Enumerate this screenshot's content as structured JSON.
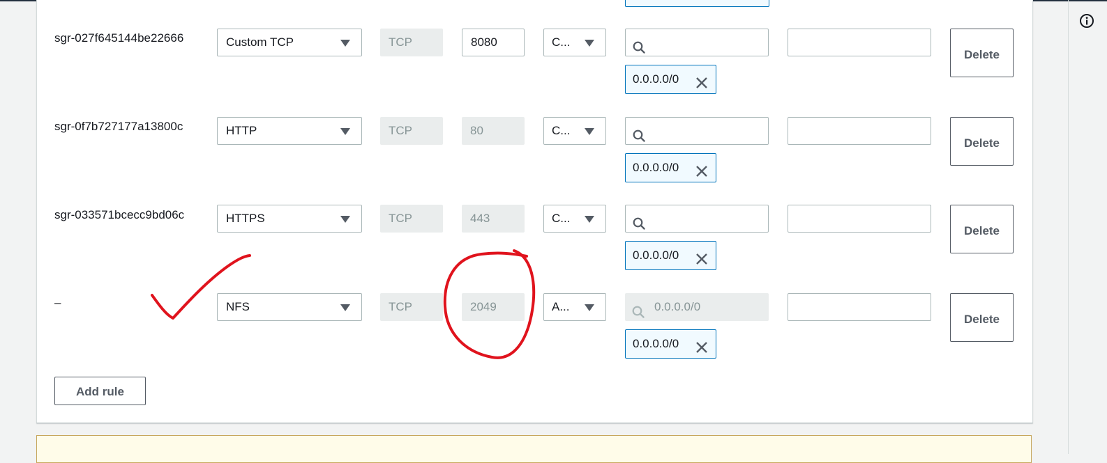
{
  "rules": [
    {
      "id": "sgr-027f645144be22666",
      "type": "Custom TCP",
      "protocol": "TCP",
      "port": "8080",
      "port_editable": true,
      "source_type": "C...",
      "search_placeholder": "",
      "token": "0.0.0.0/0",
      "description": "",
      "delete_label": "Delete"
    },
    {
      "id": "sgr-0f7b727177a13800c",
      "type": "HTTP",
      "protocol": "TCP",
      "port": "80",
      "port_editable": false,
      "source_type": "C...",
      "search_placeholder": "",
      "token": "0.0.0.0/0",
      "description": "",
      "delete_label": "Delete"
    },
    {
      "id": "sgr-033571bcecc9bd06c",
      "type": "HTTPS",
      "protocol": "TCP",
      "port": "443",
      "port_editable": false,
      "source_type": "C...",
      "search_placeholder": "",
      "token": "0.0.0.0/0",
      "description": "",
      "delete_label": "Delete"
    },
    {
      "id": "–",
      "type": "NFS",
      "protocol": "TCP",
      "port": "2049",
      "port_editable": false,
      "source_type": "A...",
      "search_placeholder": "0.0.0.0/0",
      "token": "0.0.0.0/0",
      "description": "",
      "delete_label": "Delete"
    }
  ],
  "add_rule_label": "Add rule",
  "icons": {
    "search": "search-icon",
    "remove": "close-icon",
    "dropdown": "caret-down-icon",
    "info": "info-icon"
  },
  "colors": {
    "annotation": "#e0131d",
    "token_border": "#0073bb",
    "token_bg": "#f1faff",
    "disabled_bg": "#eaeded",
    "warning_bg": "#fffce9"
  }
}
